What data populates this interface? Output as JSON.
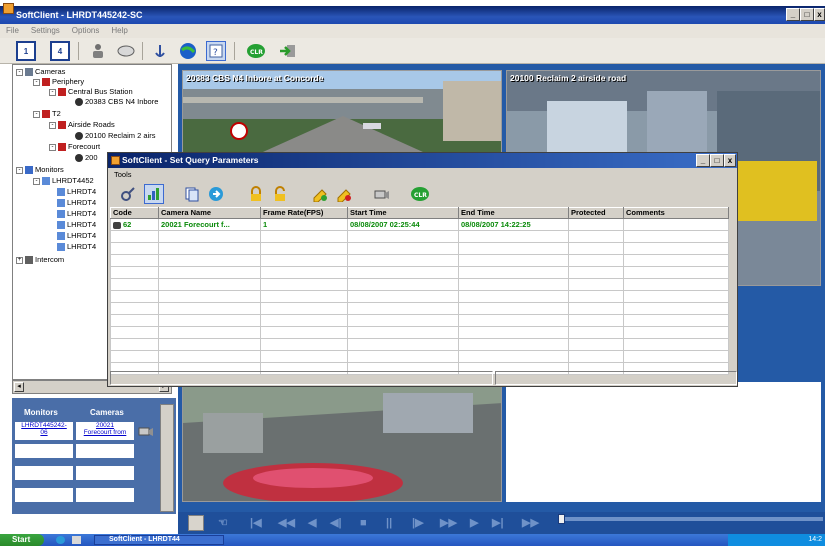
{
  "window": {
    "title": "SoftClient - LHRDT445242-SC",
    "min": "_",
    "max": "□",
    "close": "x"
  },
  "menu": {
    "items": [
      "File",
      "Settings",
      "Options",
      "Help"
    ]
  },
  "toolbar": {
    "btn1": "1",
    "btn2": "4",
    "clr": "CLR"
  },
  "tree": {
    "rows": [
      {
        "label": "Cameras",
        "icon": "cameras-icon"
      },
      {
        "label": "Periphery",
        "icon": "building-icon"
      },
      {
        "label": "Central Bus Station",
        "icon": "building-icon"
      },
      {
        "label": "20383 CBS N4 Inbore",
        "icon": "camera-icon"
      },
      {
        "label": "T2",
        "icon": "building-icon"
      },
      {
        "label": "Airside Roads",
        "icon": "building-icon"
      },
      {
        "label": "20100 Reclaim 2 airs",
        "icon": "camera-icon"
      },
      {
        "label": "Forecourt",
        "icon": "building-icon"
      },
      {
        "label": "200",
        "icon": "camera-icon"
      },
      {
        "label": "Monitors",
        "icon": "monitors-icon"
      },
      {
        "label": "LHRDT4452",
        "icon": "monitor-icon"
      },
      {
        "label": "LHRDT4",
        "icon": "monitor-icon"
      },
      {
        "label": "LHRDT4",
        "icon": "monitor-icon"
      },
      {
        "label": "LHRDT4",
        "icon": "monitor-icon"
      },
      {
        "label": "LHRDT4",
        "icon": "monitor-icon"
      },
      {
        "label": "LHRDT4",
        "icon": "monitor-icon"
      },
      {
        "label": "LHRDT4",
        "icon": "monitor-icon"
      },
      {
        "label": "Intercom",
        "icon": "intercom-icon"
      }
    ]
  },
  "mc_panel": {
    "monitors_header": "Monitors",
    "cameras_header": "Cameras",
    "monitor_link": "LHRDT445242-\n06",
    "camera_link": "20021\nForecourt from"
  },
  "tiles": {
    "t1_label": "20383 CBS N4 Inbore at Concorde",
    "t2_label": "20100 Reclaim 2 airside road"
  },
  "dialog": {
    "title": "SoftClient - Set Query Parameters",
    "menu": "Tools",
    "clr": "CLR",
    "columns": [
      "Code",
      "Camera Name",
      "Frame Rate(FPS)",
      "Start Time",
      "End Time",
      "Protected",
      "Comments"
    ],
    "rows": [
      [
        "62",
        "20021 Forecourt f...",
        "1",
        "08/08/2007 02:25:44",
        "08/08/2007 14:22:25",
        "",
        ""
      ]
    ],
    "empty_rows": 12
  },
  "playback": {
    "buttons": [
      "|◀",
      "◀◀",
      "◀",
      "◀|",
      "■",
      "||",
      "|▶",
      "▶▶",
      "▶",
      "▶|",
      "▶▶"
    ]
  },
  "taskbar": {
    "start": "Start",
    "task": "SoftClient - LHRDT44",
    "clock": "14:2"
  },
  "colors": {
    "accent": "#0a246a",
    "video_bg": "#245aa6",
    "grid_text": "#0a8a0a"
  }
}
